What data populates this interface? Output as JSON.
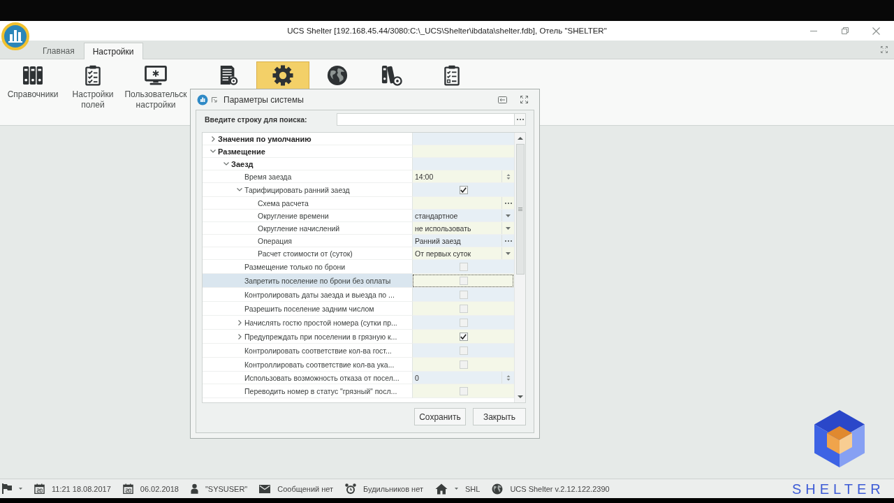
{
  "window": {
    "title": "UCS Shelter [192.168.45.44/3080:C:\\_UCS\\Shelter\\ibdata\\shelter.fdb], Отель \"SHELTER\""
  },
  "tabs": [
    {
      "label": "Главная",
      "selected": false
    },
    {
      "label": "Настройки",
      "selected": true
    }
  ],
  "ribbon": {
    "buttons": [
      {
        "label": "Справочники",
        "selected": false
      },
      {
        "label": "Настройки полей",
        "selected": false
      },
      {
        "label": "Пользовательск настройки",
        "selected": false
      },
      {
        "selected": false
      },
      {
        "selected": true
      },
      {
        "selected": false
      },
      {
        "selected": false
      },
      {
        "selected": false
      }
    ]
  },
  "dialog": {
    "title": "Параметры системы",
    "search": {
      "label": "Введите строку для поиска:"
    },
    "rows": [
      {
        "label": "Значения по умолчанию",
        "kind": "group",
        "expanded": false,
        "selected": false
      },
      {
        "label": "Размещение",
        "kind": "group",
        "expanded": true,
        "selected": false,
        "children": [
          {
            "label": "Заезд",
            "kind": "group",
            "expanded": true,
            "selected": false,
            "children": [
              {
                "label": "Время заезда",
                "kind": "spin",
                "value": "14:00",
                "selected": false
              },
              {
                "label": "Тарифицировать ранний заезд",
                "kind": "check",
                "checked": true,
                "expanded": true,
                "selected": false,
                "children": [
                  {
                    "label": "Схема расчета",
                    "kind": "picker",
                    "selected": false
                  },
                  {
                    "label": "Округление времени",
                    "kind": "dropdown",
                    "value": "стандартное",
                    "selected": false
                  },
                  {
                    "label": "Округление начислений",
                    "kind": "dropdown",
                    "value": "не использовать",
                    "selected": false
                  },
                  {
                    "label": "Операция",
                    "kind": "picker",
                    "value": "Ранний заезд",
                    "selected": false
                  },
                  {
                    "label": "Расчет стоимости от (суток)",
                    "kind": "dropdown",
                    "value": "От первых суток",
                    "selected": false
                  }
                ]
              },
              {
                "label": "Размещение только по брони",
                "kind": "check",
                "checked": false,
                "selected": false
              },
              {
                "label": "Запретить поселение по брони без оплаты",
                "kind": "check",
                "checked": false,
                "selected": true
              },
              {
                "label": "Контролировать даты заезда и выезда по ...",
                "kind": "check",
                "checked": false,
                "selected": false
              },
              {
                "label": "Разрешить поселение задним числом",
                "kind": "check",
                "checked": false,
                "selected": false
              },
              {
                "label": "Начислять гостю простой номера (сутки пр...",
                "kind": "check",
                "checked": false,
                "expanded": false,
                "selected": false
              },
              {
                "label": "Предупреждать при поселении в грязную к...",
                "kind": "check",
                "checked": true,
                "expanded": false,
                "selected": false
              },
              {
                "label": "Контролировать соответствие кол-ва гост...",
                "kind": "check",
                "checked": false,
                "selected": false
              },
              {
                "label": "Контроллировать соответствие кол-ва ука...",
                "kind": "check",
                "checked": false,
                "selected": false
              },
              {
                "label": "Использовать возможность отказа от посел...",
                "kind": "spin",
                "value": "0",
                "selected": false
              },
              {
                "label": "Переводить номер в статус \"грязный\" посл...",
                "kind": "check",
                "checked": false,
                "selected": false
              }
            ]
          }
        ]
      }
    ],
    "buttons": [
      "Сохранить",
      "Закрыть"
    ]
  },
  "status_bar": {
    "items": [
      {
        "text": "11:21 18.08.2017"
      },
      {
        "text": "06.02.2018"
      },
      {
        "text": "\"SYSUSER\""
      },
      {
        "text": "Сообщений нет"
      },
      {
        "text": "Будильников нет"
      },
      {
        "text": "SHL"
      },
      {
        "text": "UCS Shelter v.2.12.122.2390"
      }
    ]
  },
  "brand_logo": {
    "text": "SHELTER"
  }
}
